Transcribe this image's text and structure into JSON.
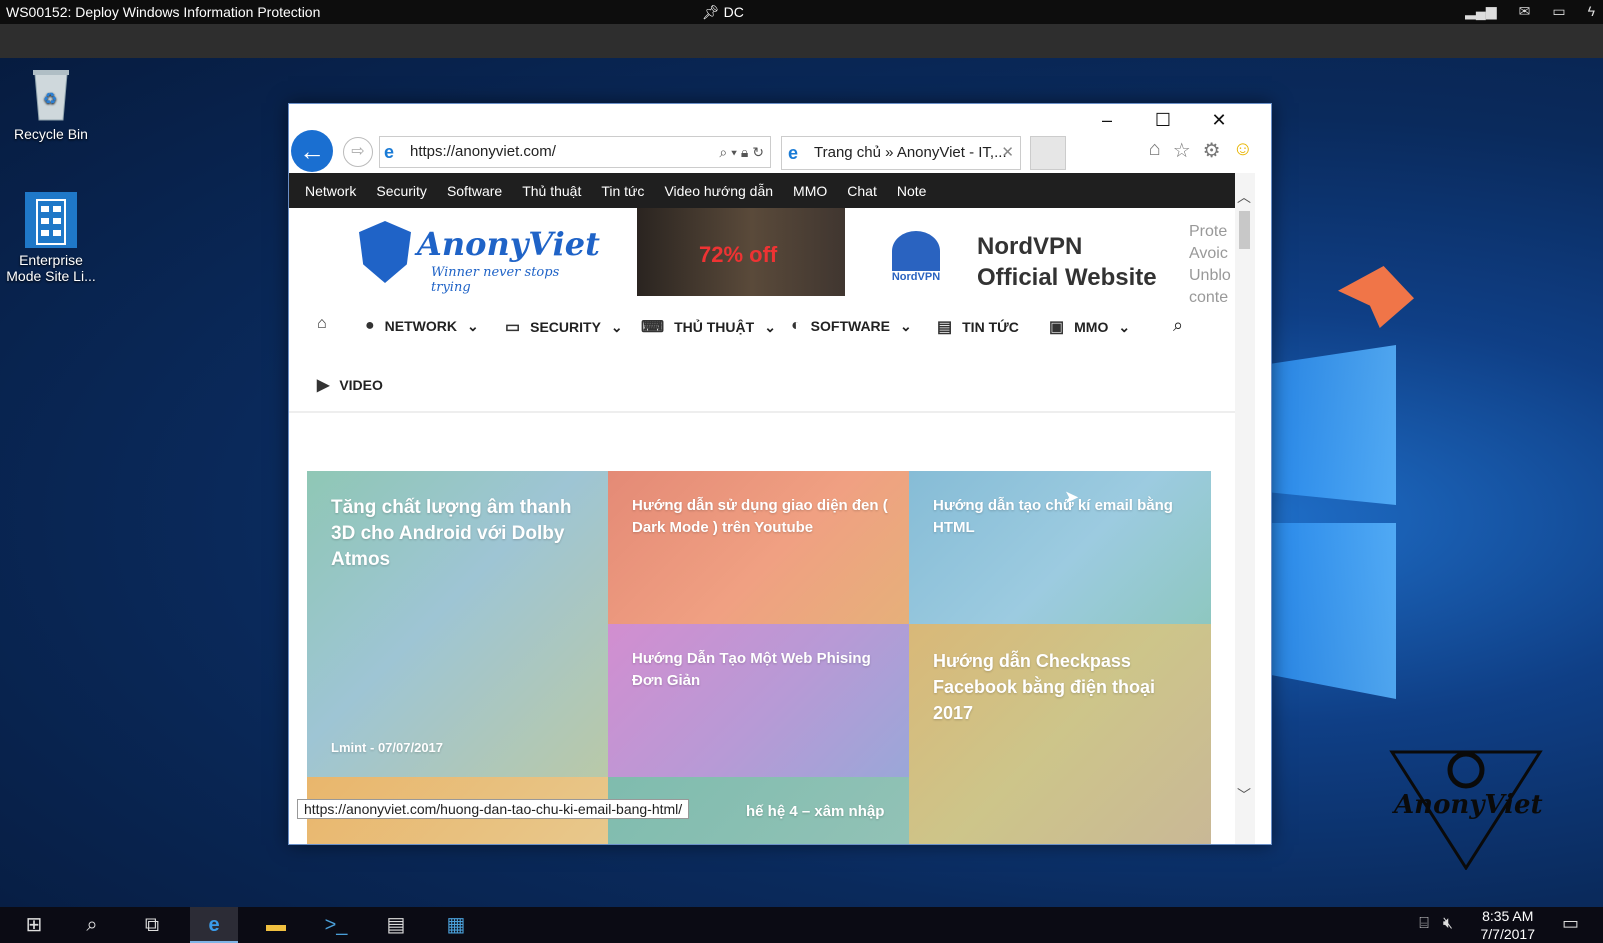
{
  "rdp": {
    "title": "WS00152: Deploy Windows Information Protection",
    "center": "DC"
  },
  "desktop": {
    "icons": [
      {
        "label": "Recycle Bin"
      },
      {
        "label": "Enterprise Mode Site Li..."
      }
    ]
  },
  "ie": {
    "address": "https://anonyviet.com/",
    "tab_title": "Trang chủ » AnonyViet - IT,...",
    "status_url": "https://anonyviet.com/huong-dan-tao-chu-ki-email-bang-html/"
  },
  "site": {
    "top_nav": [
      "Network",
      "Security",
      "Software",
      "Thủ thuật",
      "Tin tức",
      "Video hướng dẫn",
      "MMO",
      "Chat",
      "Note"
    ],
    "logo_name": "AnonyViet",
    "logo_tagline": "Winner never stops trying",
    "ad_text": "72% off",
    "nord_logo": "NordVPN",
    "nord_title_1": "NordVPN",
    "nord_title_2": "Official Website",
    "nord_side": [
      "Prote",
      "Avoic",
      "Unblo",
      "conte"
    ],
    "main_nav": [
      "NETWORK",
      "SECURITY",
      "THỦ THUẬT",
      "SOFTWARE",
      "TIN TỨC",
      "MMO",
      "VIDEO"
    ],
    "tiles": [
      {
        "title": "Tăng chất lượng âm thanh 3D cho Android với Dolby Atmos",
        "author": "Lmint",
        "date": "07/07/2017"
      },
      {
        "title": "Hướng dẫn sử dụng giao diện đen ( Dark Mode ) trên Youtube"
      },
      {
        "title": "Hướng dẫn tạo chữ kí email bằng HTML"
      },
      {
        "title": "Hướng Dẫn Tạo Một Web Phising Đơn Giản"
      },
      {
        "title": "Hướng dẫn Checkpass Facebook bằng điện thoại 2017"
      },
      {
        "title": "hế hệ 4 – xâm nhập"
      }
    ]
  },
  "watermark": "AnonyViet",
  "taskbar": {
    "time": "8:35 AM",
    "date": "7/7/2017"
  },
  "colors": {
    "ie_blue": "#1a6fd1",
    "nav_dark": "#1f1f1f"
  }
}
